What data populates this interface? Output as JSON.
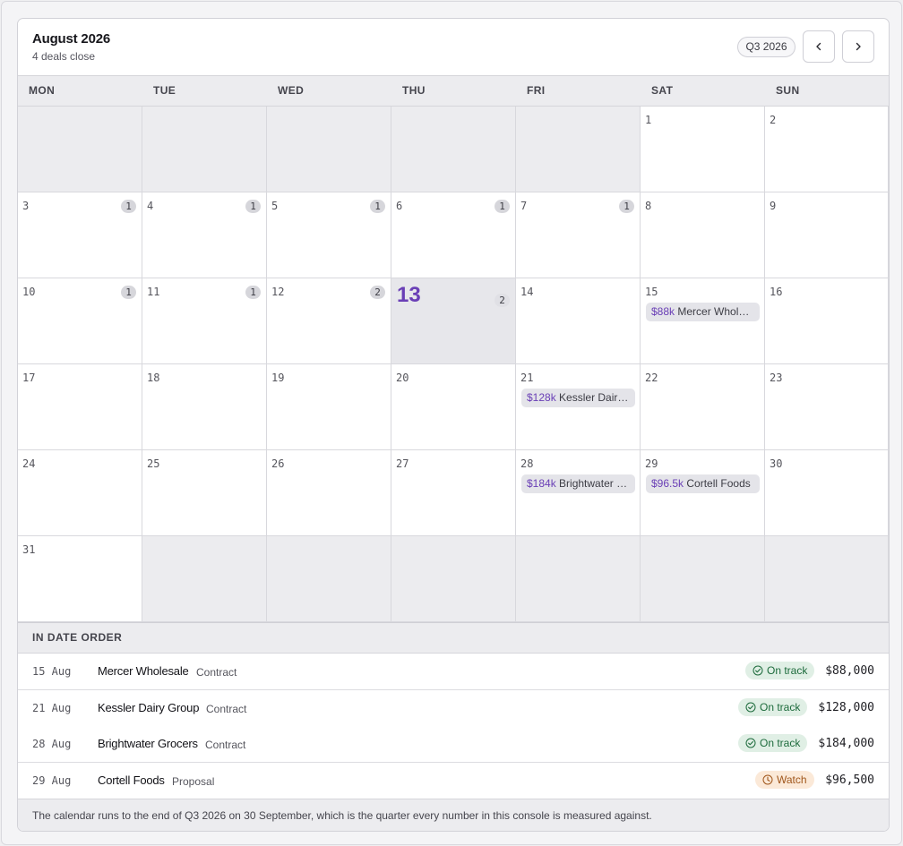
{
  "header": {
    "title": "August 2026",
    "subtitle": "4 deals close",
    "quarter": "Q3 2026"
  },
  "weekdays": [
    "MON",
    "TUE",
    "WED",
    "THU",
    "FRI",
    "SAT",
    "SUN"
  ],
  "weeks": [
    [
      null,
      null,
      null,
      null,
      null,
      {
        "day": "1"
      },
      {
        "day": "2"
      }
    ],
    [
      {
        "day": "3",
        "count": "1"
      },
      {
        "day": "4",
        "count": "1"
      },
      {
        "day": "5",
        "count": "1"
      },
      {
        "day": "6",
        "count": "1"
      },
      {
        "day": "7",
        "count": "1"
      },
      {
        "day": "8"
      },
      {
        "day": "9"
      }
    ],
    [
      {
        "day": "10",
        "count": "1"
      },
      {
        "day": "11",
        "count": "1"
      },
      {
        "day": "12",
        "count": "2"
      },
      {
        "day": "13",
        "count": "2",
        "today": true
      },
      {
        "day": "14"
      },
      {
        "day": "15",
        "chip": {
          "amount": "$88k",
          "name": "Mercer Wholesale"
        }
      },
      {
        "day": "16"
      }
    ],
    [
      {
        "day": "17"
      },
      {
        "day": "18"
      },
      {
        "day": "19"
      },
      {
        "day": "20"
      },
      {
        "day": "21",
        "chip": {
          "amount": "$128k",
          "name": "Kessler Dairy Group"
        }
      },
      {
        "day": "22"
      },
      {
        "day": "23"
      }
    ],
    [
      {
        "day": "24"
      },
      {
        "day": "25"
      },
      {
        "day": "26"
      },
      {
        "day": "27"
      },
      {
        "day": "28",
        "chip": {
          "amount": "$184k",
          "name": "Brightwater Grocers"
        }
      },
      {
        "day": "29",
        "chip": {
          "amount": "$96.5k",
          "name": "Cortell Foods"
        }
      },
      {
        "day": "30"
      }
    ],
    [
      {
        "day": "31"
      },
      null,
      null,
      null,
      null,
      null,
      null
    ]
  ],
  "list": {
    "heading": "IN DATE ORDER",
    "rows": [
      {
        "date": "15 Aug",
        "name": "Mercer Wholesale",
        "stage": "Contract",
        "status": "On track",
        "status_kind": "ok",
        "value": "$88,000"
      },
      {
        "date": "21 Aug",
        "name": "Kessler Dairy Group",
        "stage": "Contract",
        "status": "On track",
        "status_kind": "ok",
        "value": "$128,000"
      },
      {
        "date": "28 Aug",
        "name": "Brightwater Grocers",
        "stage": "Contract",
        "status": "On track",
        "status_kind": "ok",
        "value": "$184,000"
      },
      {
        "date": "29 Aug",
        "name": "Cortell Foods",
        "stage": "Proposal",
        "status": "Watch",
        "status_kind": "watch",
        "value": "$96,500"
      }
    ]
  },
  "footer": "The calendar runs to the end of Q3 2026 on 30 September, which is the quarter every number in this console is measured against.",
  "colors": {
    "accent": "#6a3fb6",
    "ok": "#1d6b3c",
    "watch": "#a0561b"
  },
  "icons": {
    "prev": "chevron-left-icon",
    "next": "chevron-right-icon",
    "ok": "check-circle-icon",
    "watch": "clock-icon"
  }
}
